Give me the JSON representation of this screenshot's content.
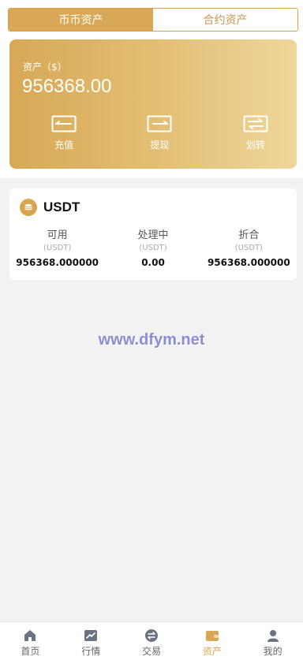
{
  "tabs": [
    {
      "label": "币币资产",
      "active": true
    },
    {
      "label": "合约资产",
      "active": false
    }
  ],
  "asset": {
    "label": "资产（$）",
    "value": "956368.00",
    "actions": [
      {
        "label": "充值",
        "icon": "deposit-icon"
      },
      {
        "label": "提现",
        "icon": "withdraw-icon"
      },
      {
        "label": "划转",
        "icon": "transfer-icon"
      }
    ]
  },
  "coin": {
    "name": "USDT",
    "icon": "coin-icon",
    "columns": [
      {
        "title": "可用",
        "unit": "(USDT)",
        "value": "956368.000000"
      },
      {
        "title": "处理中",
        "unit": "(USDT)",
        "value": "0.00"
      },
      {
        "title": "折合",
        "unit": "(USDT)",
        "value": "956368.000000"
      }
    ]
  },
  "watermark": "www.dfym.net",
  "tabbar": [
    {
      "label": "首页",
      "icon": "home-icon",
      "active": false
    },
    {
      "label": "行情",
      "icon": "chart-icon",
      "active": false
    },
    {
      "label": "交易",
      "icon": "trade-icon",
      "active": false
    },
    {
      "label": "资产",
      "icon": "wallet-icon",
      "active": true
    },
    {
      "label": "我的",
      "icon": "user-icon",
      "active": false
    }
  ],
  "colors": {
    "accent": "#d8a856",
    "card_start": "#d7a855",
    "card_end": "#efd69a"
  }
}
